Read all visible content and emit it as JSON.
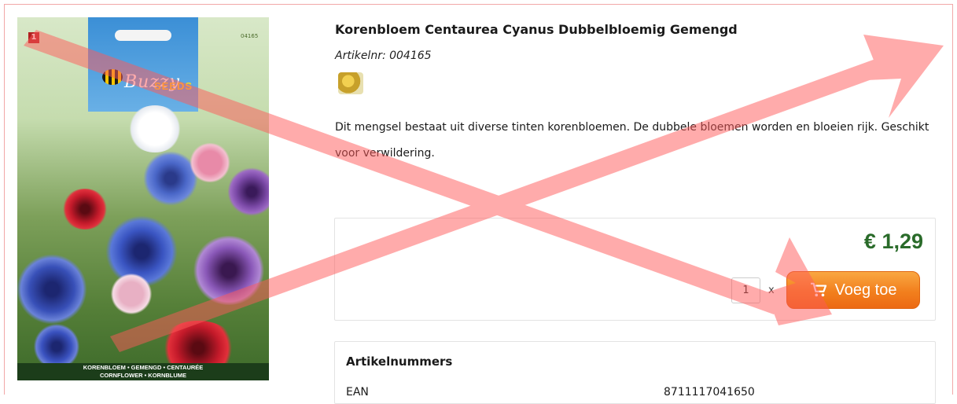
{
  "product": {
    "title": "Korenbloem Centaurea Cyanus Dubbelbloemig Gemengd",
    "article_no": "Artikelnr: 004165",
    "description": "Dit mengsel bestaat uit diverse tinten korenbloemen. De dubbele bloemen worden en bloeien rijk. Geschikt voor verwildering."
  },
  "packet": {
    "sticker": "1",
    "code": "04165",
    "brand_top": "Buzzy",
    "brand_bottom": "SEEDS",
    "label_line1": "KORENBLOEM • GEMENGD • CENTAURÉE",
    "label_line2": "CORNFLOWER • KORNBLUME"
  },
  "purchase": {
    "price": "€ 1,29",
    "quantity": "1",
    "times": "x",
    "add_label": "Voeg toe"
  },
  "articles": {
    "title": "Artikelnummers",
    "row_label": "EAN",
    "row_value": "8711117041650"
  },
  "colors": {
    "price": "#2a6b2a",
    "button": "#f27f1d",
    "overlay": "#ff6b6b"
  },
  "icons": {
    "cart": "cart-icon",
    "brand_logo": "buzzy-seeds-logo"
  }
}
